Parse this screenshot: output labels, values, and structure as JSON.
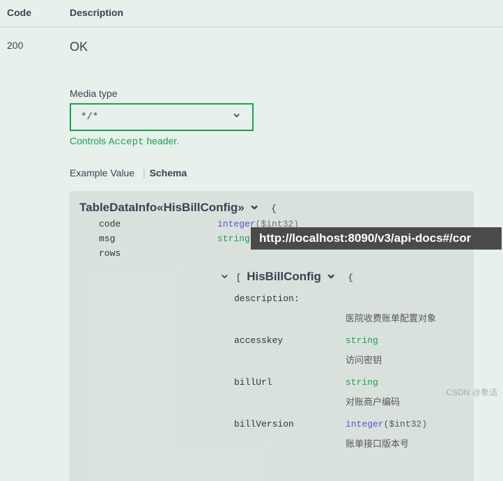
{
  "headers": {
    "code": "Code",
    "desc": "Description"
  },
  "response": {
    "code": "200",
    "status": "OK"
  },
  "media": {
    "label": "Media type",
    "selected": "*/*",
    "controls_pre": "Controls ",
    "controls_kw": "Accept",
    "controls_post": " header."
  },
  "tabs": {
    "example": "Example Value",
    "schema": "Schema"
  },
  "schema": {
    "rootName": "TableDataInfo«HisBillConfig»",
    "props": [
      {
        "name": "code",
        "type": "integer",
        "hint": "($int32)"
      },
      {
        "name": "msg",
        "type": "string",
        "hint": ""
      },
      {
        "name": "rows"
      }
    ],
    "nestedPrefix": "[",
    "nestedName": "HisBillConfig",
    "nested": {
      "descKey": "description:",
      "descVal": "医院收费账单配置对象",
      "fields": [
        {
          "name": "accesskey",
          "type": "string",
          "desc": "访问密钥"
        },
        {
          "name": "billUrl",
          "type": "string",
          "desc": "对账商户编码"
        },
        {
          "name": "billVersion",
          "type": "integer",
          "hint": "($int32)",
          "desc": "账单接口版本号"
        }
      ]
    }
  },
  "tooltip": "http://localhost:8090/v3/api-docs#/cor",
  "watermark": "CSDN @象话"
}
